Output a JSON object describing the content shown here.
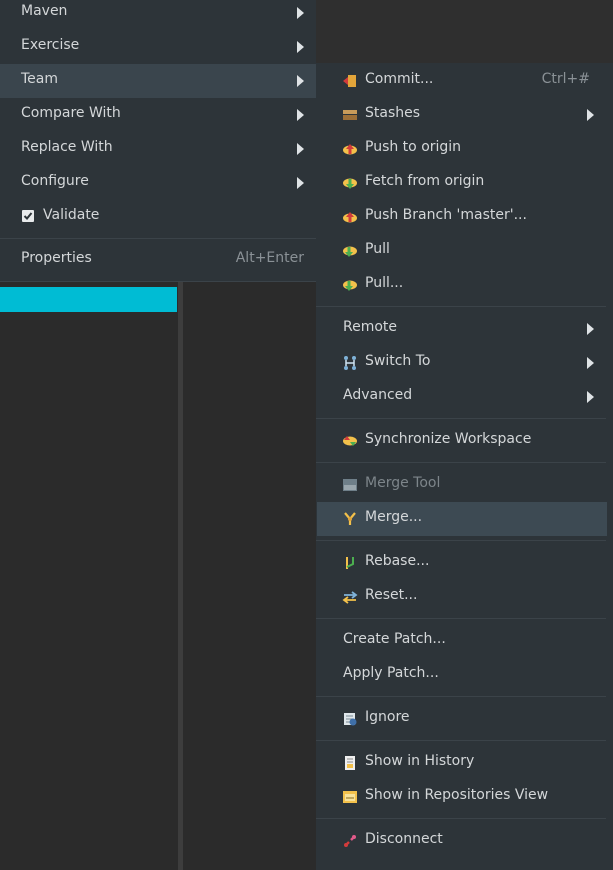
{
  "left_menu": {
    "items": [
      {
        "label": "Maven"
      },
      {
        "label": "Exercise"
      },
      {
        "label": "Team"
      },
      {
        "label": "Compare With"
      },
      {
        "label": "Replace With"
      },
      {
        "label": "Configure"
      },
      {
        "label": "Validate"
      }
    ],
    "properties": {
      "label": "Properties",
      "accelerator": "Alt+Enter"
    }
  },
  "team_submenu": {
    "items": [
      {
        "label": "Commit...",
        "accelerator": "Ctrl+#",
        "icon": "commit-icon"
      },
      {
        "label": "Stashes",
        "icon": "stashes-icon"
      },
      {
        "label": "Push to origin",
        "icon": "push-icon"
      },
      {
        "label": "Fetch from origin",
        "icon": "fetch-icon"
      },
      {
        "label": "Push Branch 'master'...",
        "icon": "push-branch-icon"
      },
      {
        "label": "Pull",
        "icon": "pull-icon"
      },
      {
        "label": "Pull...",
        "icon": "pull-dialog-icon"
      },
      {
        "label": "Remote"
      },
      {
        "label": "Switch To",
        "icon": "switch-branch-icon"
      },
      {
        "label": "Advanced"
      },
      {
        "label": "Synchronize Workspace",
        "icon": "synchronize-icon"
      },
      {
        "label": "Merge Tool",
        "icon": "merge-tool-icon"
      },
      {
        "label": "Merge...",
        "icon": "merge-icon"
      },
      {
        "label": "Rebase...",
        "icon": "rebase-icon"
      },
      {
        "label": "Reset...",
        "icon": "reset-icon"
      },
      {
        "label": "Create Patch..."
      },
      {
        "label": "Apply Patch..."
      },
      {
        "label": "Ignore",
        "icon": "ignore-icon"
      },
      {
        "label": "Show in History",
        "icon": "history-icon"
      },
      {
        "label": "Show in Repositories View",
        "icon": "repositories-icon"
      },
      {
        "label": "Disconnect",
        "icon": "disconnect-icon"
      }
    ]
  },
  "colors": {
    "menu_bg": "#2d3439",
    "highlight": "#3a454d",
    "hover": "#3d4a53",
    "accent_bar": "#00bcd4",
    "text": "#d4d7d9",
    "disabled_text": "#7d858a"
  }
}
